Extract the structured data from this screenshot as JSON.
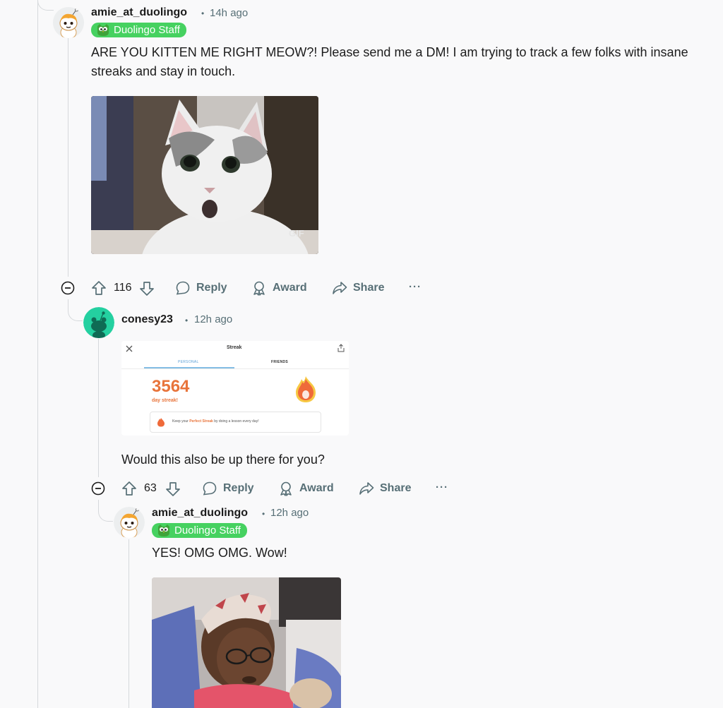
{
  "comments": [
    {
      "author": "amie_at_duolingo",
      "separator": "•",
      "time": "14h ago",
      "flair": "Duolingo Staff",
      "text": "ARE YOU KITTEN ME RIGHT MEOW?! Please send me a DM! I am trying to track a few folks with insane streaks and stay in touch.",
      "media": {
        "type": "gif",
        "label": "GIF",
        "subject": "surprised cat"
      },
      "score": "116",
      "actions": {
        "reply": "Reply",
        "award": "Award",
        "share": "Share",
        "more": "···"
      }
    },
    {
      "author": "conesy23",
      "separator": "•",
      "time": "12h ago",
      "media": {
        "type": "screenshot",
        "header_title": "Streak",
        "tab_personal": "PERSONAL",
        "tab_friends": "FRIENDS",
        "streak_value": "3564",
        "streak_label": "day streak!",
        "note_prefix": "Keep your ",
        "note_highlight": "Perfect Streak",
        "note_suffix": " by doing a lesson every day!"
      },
      "text": "Would this also be up there for you?",
      "score": "63",
      "actions": {
        "reply": "Reply",
        "award": "Award",
        "share": "Share",
        "more": "···"
      }
    },
    {
      "author": "amie_at_duolingo",
      "separator": "•",
      "time": "12h ago",
      "flair": "Duolingo Staff",
      "text": "YES! OMG OMG. Wow!",
      "media": {
        "type": "gif",
        "subject": "surprised girl with headband"
      }
    }
  ],
  "colors": {
    "flair": "#46d160",
    "streak": "#e8743b",
    "meta": "#576f76",
    "thread_line": "#d6d9dc"
  }
}
